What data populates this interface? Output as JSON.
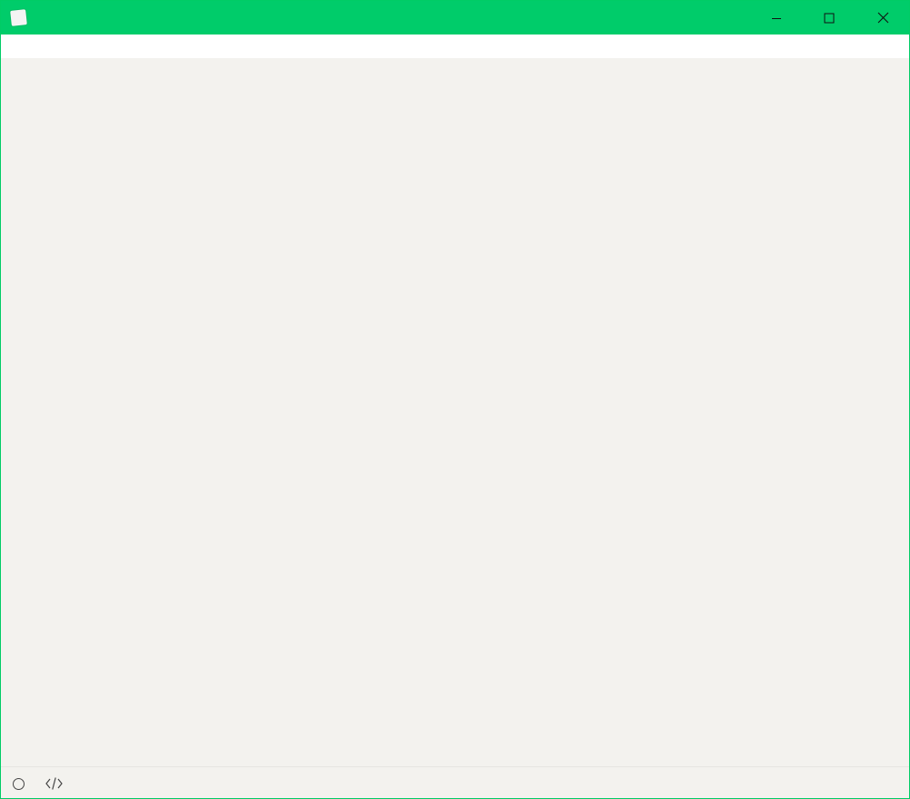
{
  "window": {
    "title": "",
    "app_icon_letter": "",
    "accent_color": "#00cc6a",
    "editor_background": "#f3f2ee"
  },
  "title_controls": {
    "minimize_icon": "minimize-icon",
    "maximize_icon": "maximize-icon",
    "close_icon": "close-icon"
  },
  "menubar": {
    "items": [
      {
        "label": ""
      },
      {
        "label": ""
      },
      {
        "label": ""
      },
      {
        "label": ""
      },
      {
        "label": ""
      },
      {
        "label": ""
      },
      {
        "label": ""
      }
    ]
  },
  "statusbar": {
    "outline_toggle_icon": "circle-icon",
    "source_mode_icon": "code-icon",
    "word_count": ""
  }
}
